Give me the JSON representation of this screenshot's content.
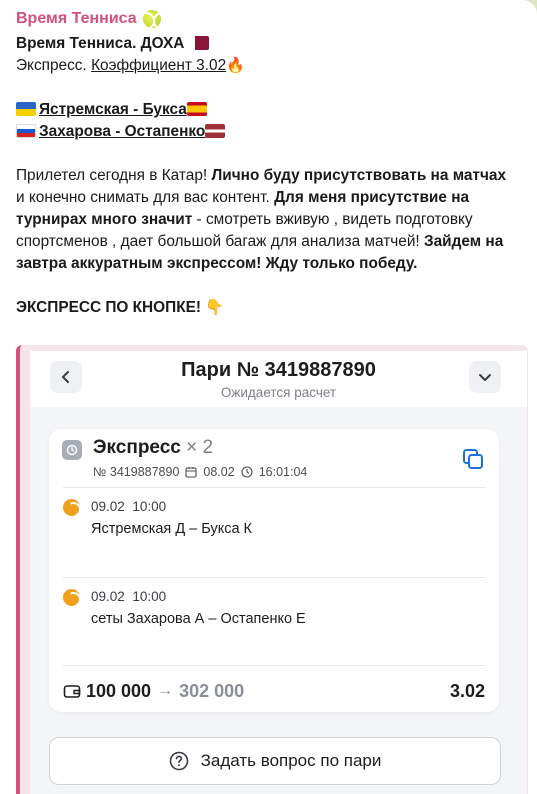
{
  "channel": {
    "name": "Время Тенниса"
  },
  "message": {
    "headline": "Время Тенниса. ДОХА",
    "express_prefix": "Экспресс.",
    "coef_link": "Коэффициент 3.02",
    "match1": "Ястремская - Букса",
    "match2": "Захарова - Остапенко",
    "p1_a": "Прилетел сегодня в Катар! ",
    "p1_b": "Лично буду присутствовать на матчах",
    "p1_c": " и конечно снимать для вас контент. ",
    "p1_d": "Для меня присутствие на турнирах много значит",
    "p1_e": " - смотреть вживую , видеть подготовку спортсменов , дает большой багаж для анализа матчей! ",
    "p1_f": "Зайдем на завтра аккуратным экспрессом! Жду только победу.",
    "cta": "ЭКСПРЕСС ПО КНОПКЕ!"
  },
  "bet": {
    "title": "Пари № 3419887890",
    "status": "Ожидается расчет",
    "type": "Экспресс",
    "multiplier": "× 2",
    "number": "№ 3419887890",
    "date": "08.02",
    "time": "16:01:04",
    "legs": [
      {
        "date": "09.02",
        "time": "10:00",
        "name": "Ястремская Д – Букса К"
      },
      {
        "date": "09.02",
        "time": "10:00",
        "name": "сеты Захарова А – Остапенко Е"
      }
    ],
    "stake": "100 000",
    "arrow": "→",
    "payout": "302 000",
    "coef": "3.02",
    "ask_button": "Задать вопрос по пари"
  },
  "icons": {
    "back": "chevron-left-icon",
    "expand": "chevron-down-icon",
    "clock": "clock-icon",
    "calendar": "calendar-icon",
    "copy": "copy-icon",
    "tennis": "tennis-ball-icon",
    "wallet": "wallet-icon",
    "help": "question-icon"
  },
  "colors": {
    "accent": "#d2517e",
    "leg_icon": "#f0a11c"
  }
}
